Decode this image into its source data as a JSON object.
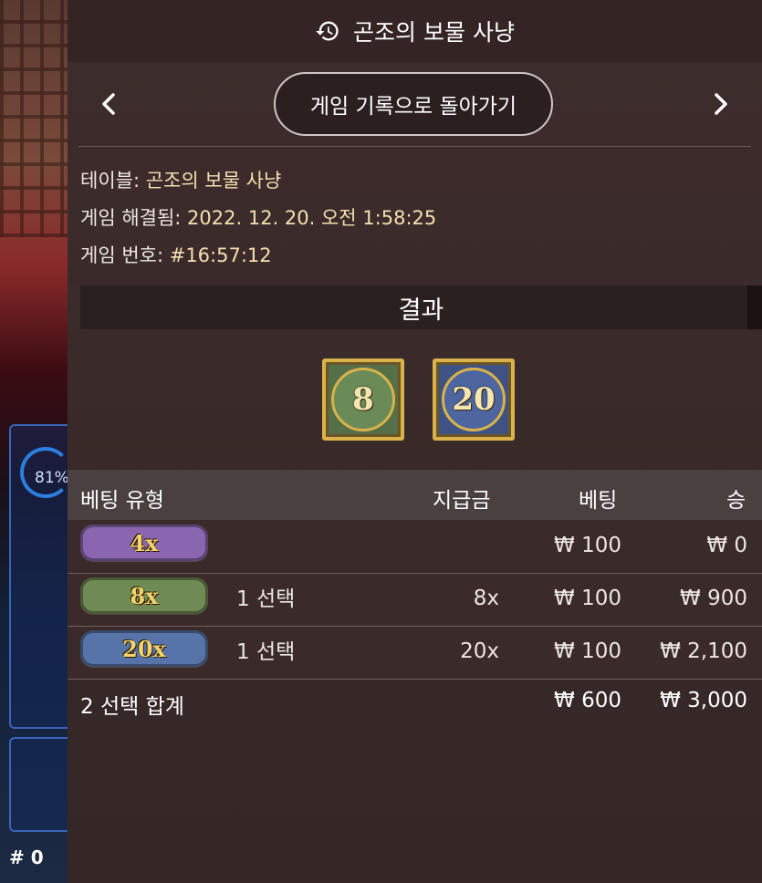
{
  "background": {
    "progress_label": "81%",
    "round_label": "# 0"
  },
  "header": {
    "title": "곤조의 보물 사냥",
    "back_button": "게임 기록으로 돌아가기"
  },
  "info": {
    "table_key": "테이블:",
    "table_value": "곤조의 보물 사냥",
    "resolved_key": "게임 해결됨:",
    "resolved_value": "2022. 12. 20. 오전 1:58:25",
    "game_no_key": "게임 번호:",
    "game_no_value": "#16:57:12"
  },
  "result": {
    "label": "결과",
    "tiles": [
      {
        "value": "8",
        "color": "#556f48"
      },
      {
        "value": "20",
        "color": "#3e5283"
      }
    ]
  },
  "table": {
    "headers": [
      "베팅 유형",
      "지급금",
      "베팅",
      "승"
    ],
    "rows": [
      {
        "badge": "4x",
        "badge_color": "#8a66b0",
        "selection": "",
        "payout": "",
        "bet": "₩ 100",
        "win": "₩ 0"
      },
      {
        "badge": "8x",
        "badge_color": "#6f8a52",
        "selection": "1 선택",
        "payout": "8x",
        "bet": "₩ 100",
        "win": "₩ 900"
      },
      {
        "badge": "20x",
        "badge_color": "#5674a8",
        "selection": "1 선택",
        "payout": "20x",
        "bet": "₩ 100",
        "win": "₩ 2,100"
      }
    ],
    "total": {
      "label": "2 선택 합계",
      "bet": "₩ 600",
      "win": "₩ 3,000"
    }
  }
}
